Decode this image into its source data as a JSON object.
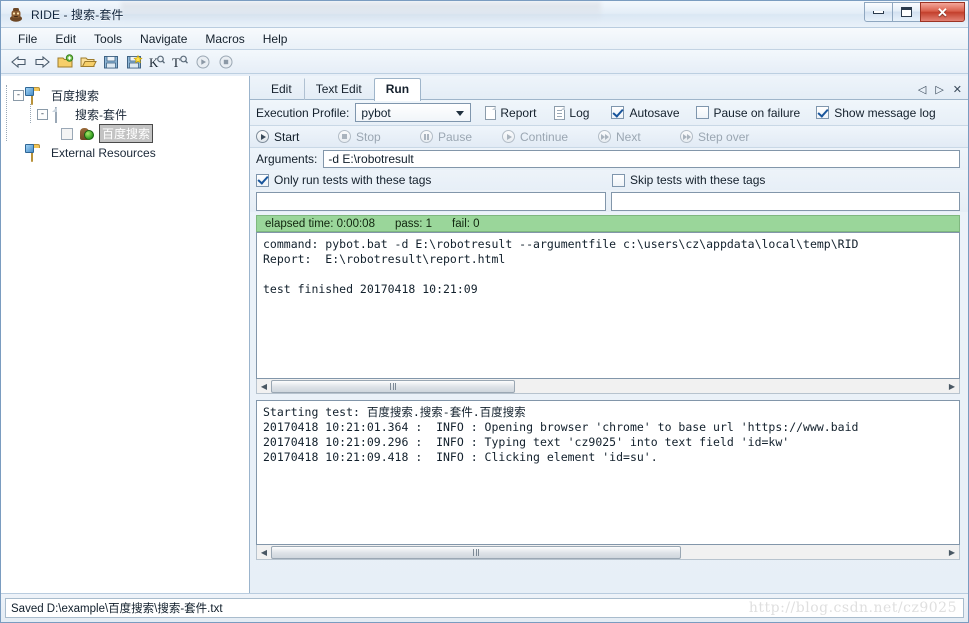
{
  "window": {
    "title": "RIDE - 搜索-套件",
    "icon": "robot-icon",
    "minimize_label": "Minimize",
    "maximize_label": "Maximize",
    "close_label": "Close"
  },
  "menubar": {
    "items": [
      {
        "label": "File"
      },
      {
        "label": "Edit"
      },
      {
        "label": "Tools"
      },
      {
        "label": "Navigate"
      },
      {
        "label": "Macros"
      },
      {
        "label": "Help"
      }
    ]
  },
  "toolbar": {
    "buttons": [
      {
        "icon": "back-arrow-icon",
        "label": "Back"
      },
      {
        "icon": "forward-arrow-icon",
        "label": "Forward"
      },
      {
        "icon": "new-project-icon",
        "label": "New Project"
      },
      {
        "icon": "open-folder-icon",
        "label": "Open"
      },
      {
        "icon": "save-icon",
        "label": "Save"
      },
      {
        "icon": "save-all-icon",
        "label": "Save All"
      },
      {
        "icon": "search-keyword-icon",
        "label": "K"
      },
      {
        "icon": "search-tests-icon",
        "label": "T"
      },
      {
        "icon": "run-icon",
        "label": "Run"
      },
      {
        "icon": "stop-icon",
        "label": "Stop"
      }
    ]
  },
  "tree": {
    "nodes": [
      {
        "label": "百度搜索",
        "icon": "project-folder-icon",
        "expander": "-",
        "level": 1,
        "selected": false
      },
      {
        "label": "搜索-套件",
        "icon": "suite-file-icon",
        "expander": "-",
        "level": 2,
        "selected": false
      },
      {
        "label": "百度搜索",
        "icon": "test-robot-icon",
        "expander": "",
        "level": 3,
        "selected": true
      },
      {
        "label": "External Resources",
        "icon": "resources-folder-icon",
        "expander": "",
        "level": 1,
        "selected": false
      }
    ]
  },
  "tabs": {
    "items": [
      {
        "label": "Edit",
        "active": false
      },
      {
        "label": "Text Edit",
        "active": false
      },
      {
        "label": "Run",
        "active": true
      }
    ],
    "nav": {
      "prev": "◁",
      "next": "▷",
      "close": "✕"
    }
  },
  "exec": {
    "profile_label": "Execution Profile:",
    "profile_value": "pybot",
    "report_label": "Report",
    "log_label": "Log",
    "autosave_label": "Autosave",
    "autosave_checked": true,
    "pause_on_failure_label": "Pause on failure",
    "pause_on_failure_checked": false,
    "show_message_log_label": "Show message log",
    "show_message_log_checked": true
  },
  "run_controls": {
    "start": {
      "label": "Start",
      "enabled": true
    },
    "stop": {
      "label": "Stop",
      "enabled": false
    },
    "pause": {
      "label": "Pause",
      "enabled": false
    },
    "continue": {
      "label": "Continue",
      "enabled": false
    },
    "next": {
      "label": "Next",
      "enabled": false
    },
    "step_over": {
      "label": "Step over",
      "enabled": false
    }
  },
  "arguments": {
    "label": "Arguments:",
    "value": "-d E:\\robotresult",
    "placeholder": ""
  },
  "tags": {
    "only_run_label": "Only run tests with these tags",
    "only_run_checked": true,
    "only_run_value": "",
    "skip_label": "Skip tests with these tags",
    "skip_checked": false,
    "skip_value": ""
  },
  "status": {
    "elapsed": "elapsed time: 0:00:08",
    "pass": "pass: 1",
    "fail": "fail: 0",
    "color": "#9ad69a"
  },
  "console": {
    "text": "command: pybot.bat -d E:\\robotresult --argumentfile c:\\users\\cz\\appdata\\local\\temp\\RID\nReport:  E:\\robotresult\\report.html\n\ntest finished 20170418 10:21:09"
  },
  "message_log": {
    "text": "Starting test: 百度搜索.搜索-套件.百度搜索\n20170418 10:21:01.364 :  INFO : Opening browser 'chrome' to base url 'https://www.baid\n20170418 10:21:09.296 :  INFO : Typing text 'cz9025' into text field 'id=kw'\n20170418 10:21:09.418 :  INFO : Clicking element 'id=su'."
  },
  "statusbar": {
    "text": "Saved D:\\example\\百度搜索\\搜索-套件.txt",
    "watermark": "http://blog.csdn.net/cz9025"
  }
}
